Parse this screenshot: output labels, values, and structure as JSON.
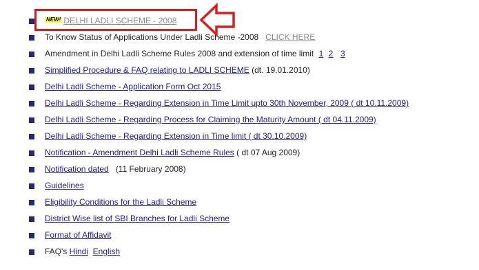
{
  "items": [
    {
      "new_badge": "NEW!",
      "link": "DELHI LADLI SCHEME - 2008"
    },
    {
      "text": "To Know Status of Applications Under Ladli Scheme -2008",
      "link": "CLICK HERE"
    },
    {
      "text": "Amendment in Delhi Ladli Scheme Rules 2008 and extension of time limit",
      "links": [
        "1",
        "2",
        "3"
      ]
    },
    {
      "link": "Simplified Procedure & FAQ relating to LADLI SCHEME",
      "suffix": "(dt. 19.01.2010)"
    },
    {
      "link": "Delhi Ladli Scheme - Application Form Oct 2015"
    },
    {
      "link": "Delhi Ladli Scheme - Regarding Extension in Time Limit upto 30th November, 2009 ( dt 10.11.2009)"
    },
    {
      "link": "Delhi Ladli Scheme - Regarding Process for Claiming the Maturity Amount ( dt 04.11.2009)"
    },
    {
      "link": "Delhi Ladli Scheme - Regarding Extension in Time limit ( dt 30.10.2009)"
    },
    {
      "link": "Notification - Amendment Delhi Ladli Scheme Rules",
      "suffix": "( dt 07 Aug 2009)"
    },
    {
      "link": "Notification dated",
      "suffix": "(11 February 2008)"
    },
    {
      "link": "Guidelines"
    },
    {
      "link": "Eligibility Conditions for the Ladli Scheme"
    },
    {
      "link": "District Wise list of SBI Branches for Ladli Scheme"
    },
    {
      "link": "Format of Affidavit"
    },
    {
      "text": "FAQ's",
      "links": [
        "Hindi",
        "English"
      ]
    }
  ],
  "colors": {
    "link": "#1a1a99",
    "muted_link": "#8a8a8a",
    "bullet": "#1f2a78",
    "highlight": "#e01b1b",
    "badge_bg": "#fffb66"
  }
}
